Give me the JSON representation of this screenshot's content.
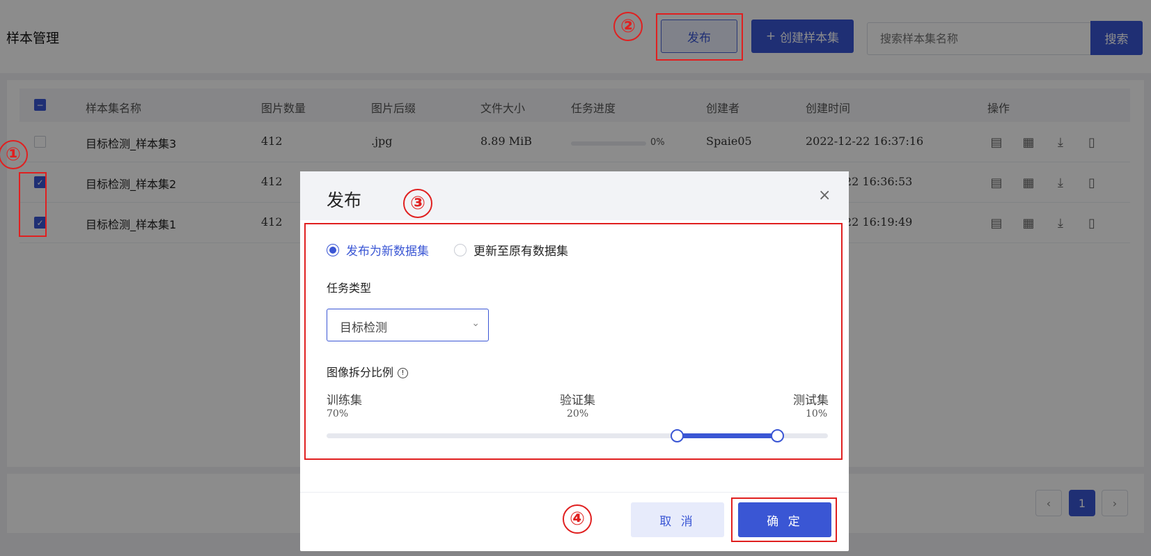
{
  "header": {
    "title": "样本管理",
    "publish_label": "发布",
    "create_label": "创建样本集",
    "create_icon": "plus-icon",
    "search_placeholder": "搜索样本集名称",
    "search_label": "搜索"
  },
  "table": {
    "columns": [
      "样本集名称",
      "图片数量",
      "图片后缀",
      "文件大小",
      "任务进度",
      "创建者",
      "创建时间",
      "操作"
    ],
    "rows": [
      {
        "name": "目标检测_样本集3",
        "count": "412",
        "suffix": ".jpg",
        "size": "8.89 MiB",
        "progress": "0%",
        "progress_value": 0,
        "creator": "Spaie05",
        "created": "2022-12-22 16:37:16",
        "checked": false
      },
      {
        "name": "目标检测_样本集2",
        "count": "412",
        "suffix": "",
        "size": "",
        "progress": "",
        "creator": "",
        "created": "22 16:36:53",
        "checked": true
      },
      {
        "name": "目标检测_样本集1",
        "count": "412",
        "suffix": "",
        "size": "",
        "progress": "",
        "creator": "",
        "created": "22 16:19:49",
        "checked": true
      }
    ],
    "row_actions": [
      "document-icon",
      "chart-icon",
      "download-icon",
      "trash-icon"
    ]
  },
  "pagination": {
    "current": "1"
  },
  "modal": {
    "title": "发布",
    "options": [
      "发布为新数据集",
      "更新至原有数据集"
    ],
    "selected_option": "发布为新数据集",
    "task_type_label": "任务类型",
    "task_type_value": "目标检测",
    "split_label": "图像拆分比例",
    "splits": [
      {
        "name": "训练集",
        "pct": "70%",
        "value": 70
      },
      {
        "name": "验证集",
        "pct": "20%",
        "value": 20
      },
      {
        "name": "测试集",
        "pct": "10%",
        "value": 10
      }
    ],
    "cancel_label": "取 消",
    "ok_label": "确 定"
  },
  "annotations": [
    "①",
    "②",
    "③",
    "④"
  ],
  "colors": {
    "accent": "#3a56d4",
    "annotation": "#e02020"
  }
}
